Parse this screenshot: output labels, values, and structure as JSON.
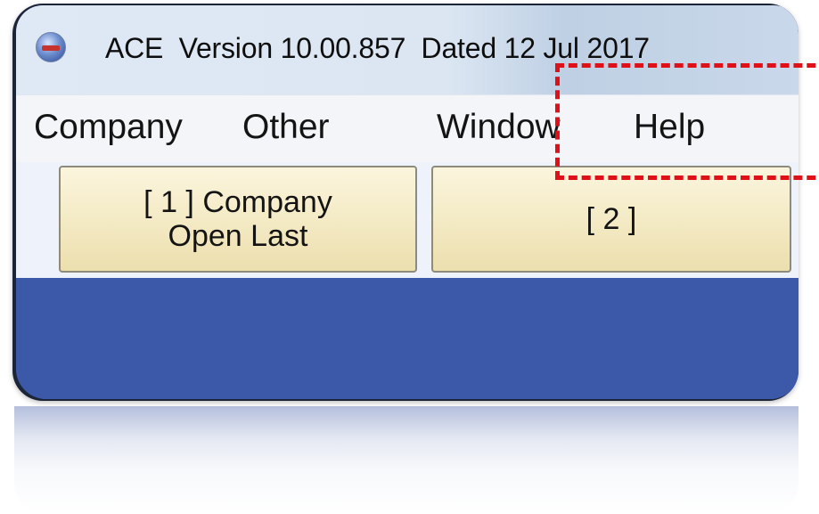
{
  "window": {
    "title": "ACE  Version 10.00.857  Dated 12 Jul 2017",
    "icon": "ace-app-icon"
  },
  "menu": {
    "items": [
      {
        "label": "Company"
      },
      {
        "label": "Other"
      },
      {
        "label": "Window"
      },
      {
        "label": "Help"
      }
    ]
  },
  "toolbar": {
    "buttons": [
      {
        "line1": "[ 1 ] Company",
        "line2": "Open Last"
      },
      {
        "line1": "[ 2 ]",
        "line2": ""
      }
    ]
  },
  "colors": {
    "workspace": "#3c58a8",
    "callout": "#e01018",
    "button_face": "#f3e9c3"
  }
}
